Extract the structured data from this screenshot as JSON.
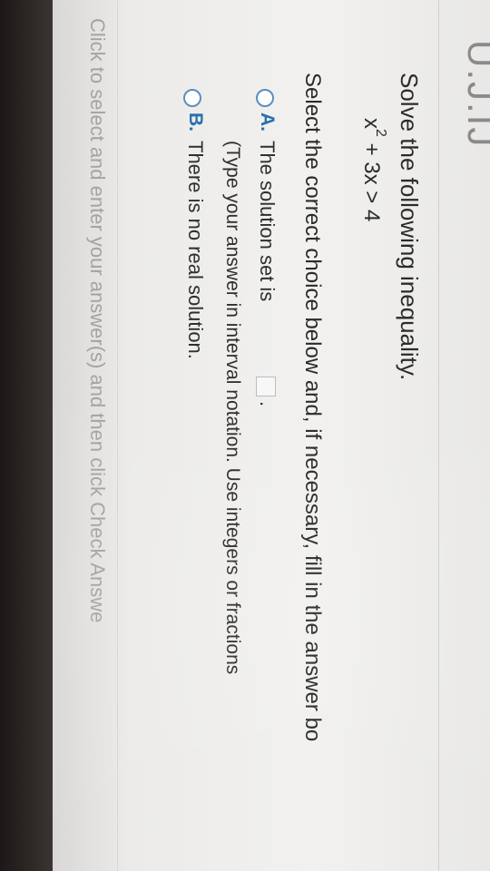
{
  "header": {
    "problem_number": "U.J.IJ"
  },
  "question": {
    "prompt": "Solve the following inequality.",
    "equation_base": "x",
    "equation_exponent": "2",
    "equation_rest": " + 3x > 4",
    "instruction": "Select the correct choice below and, if necessary, fill in the answer bo"
  },
  "choices": [
    {
      "letter": "A.",
      "text": "The solution set is",
      "hint": "(Type your answer in interval notation. Use integers or fractions",
      "answer_value": "",
      "period": "."
    },
    {
      "letter": "B.",
      "text": "There is no real solution."
    }
  ],
  "footer": {
    "text": "Click to select and enter your answer(s) and then click Check Answe"
  },
  "colors": {
    "accent": "#2a6fb0",
    "radio_border": "#5a8fc0",
    "footer_text": "#a3a3a3"
  }
}
